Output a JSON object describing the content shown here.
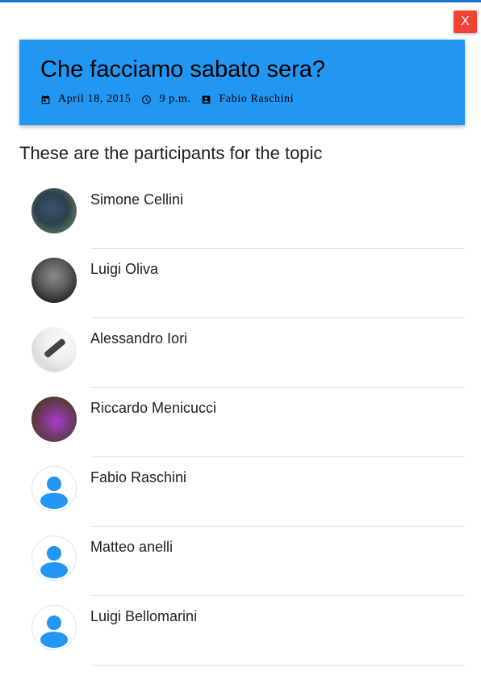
{
  "close_label": "X",
  "topic": {
    "title": "Che facciamo sabato sera?",
    "date": "April 18, 2015",
    "time": "9 p.m.",
    "author": "Fabio Raschini"
  },
  "section_title": "These are the participants for the topic",
  "participants": [
    {
      "name": "Simone Cellini",
      "avatar": "photo"
    },
    {
      "name": "Luigi Oliva",
      "avatar": "photo"
    },
    {
      "name": "Alessandro Iori",
      "avatar": "photo"
    },
    {
      "name": "Riccardo Menicucci",
      "avatar": "photo"
    },
    {
      "name": "Fabio Raschini",
      "avatar": "person-icon"
    },
    {
      "name": "Matteo anelli",
      "avatar": "person-icon"
    },
    {
      "name": "Luigi Bellomarini",
      "avatar": "person-icon"
    }
  ],
  "colors": {
    "header_bg": "#2196f3",
    "close_button": "#f44336",
    "person_icon": "#2196f3",
    "top_strip": "#1976d2"
  },
  "icons": {
    "date": "calendar-icon",
    "time": "clock-icon",
    "author": "account-box-icon",
    "generic_avatar": "person-icon"
  }
}
